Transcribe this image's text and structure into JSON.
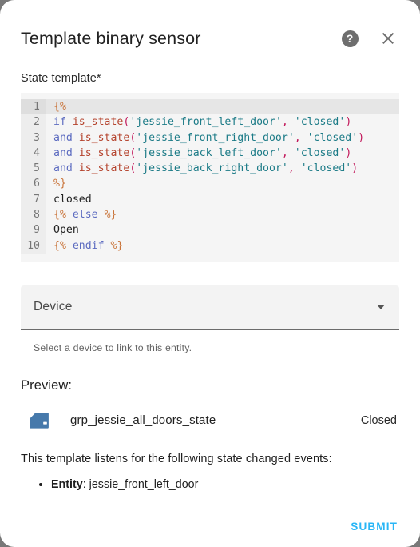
{
  "dialog": {
    "title": "Template binary sensor",
    "help_icon": "help-circle-icon",
    "close_icon": "close-icon"
  },
  "state_template": {
    "label": "State template*",
    "lines": [
      {
        "number": "1",
        "active": true,
        "tokens": [
          {
            "t": "tag",
            "v": "{%"
          }
        ]
      },
      {
        "number": "2",
        "active": false,
        "tokens": [
          {
            "t": "kw",
            "v": "if"
          },
          {
            "t": "plain",
            "v": " "
          },
          {
            "t": "fn",
            "v": "is_state"
          },
          {
            "t": "punc",
            "v": "("
          },
          {
            "t": "str",
            "v": "'jessie_front_left_door'"
          },
          {
            "t": "punc",
            "v": ","
          },
          {
            "t": "plain",
            "v": " "
          },
          {
            "t": "str",
            "v": "'closed'"
          },
          {
            "t": "punc",
            "v": ")"
          }
        ]
      },
      {
        "number": "3",
        "active": false,
        "tokens": [
          {
            "t": "kw",
            "v": "and"
          },
          {
            "t": "plain",
            "v": " "
          },
          {
            "t": "fn",
            "v": "is_state"
          },
          {
            "t": "punc",
            "v": "("
          },
          {
            "t": "str",
            "v": "'jessie_front_right_door'"
          },
          {
            "t": "punc",
            "v": ","
          },
          {
            "t": "plain",
            "v": " "
          },
          {
            "t": "str",
            "v": "'closed'"
          },
          {
            "t": "punc",
            "v": ")"
          }
        ]
      },
      {
        "number": "4",
        "active": false,
        "tokens": [
          {
            "t": "kw",
            "v": "and"
          },
          {
            "t": "plain",
            "v": " "
          },
          {
            "t": "fn",
            "v": "is_state"
          },
          {
            "t": "punc",
            "v": "("
          },
          {
            "t": "str",
            "v": "'jessie_back_left_door'"
          },
          {
            "t": "punc",
            "v": ","
          },
          {
            "t": "plain",
            "v": " "
          },
          {
            "t": "str",
            "v": "'closed'"
          },
          {
            "t": "punc",
            "v": ")"
          }
        ]
      },
      {
        "number": "5",
        "active": false,
        "tokens": [
          {
            "t": "kw",
            "v": "and"
          },
          {
            "t": "plain",
            "v": " "
          },
          {
            "t": "fn",
            "v": "is_state"
          },
          {
            "t": "punc",
            "v": "("
          },
          {
            "t": "str",
            "v": "'jessie_back_right_door'"
          },
          {
            "t": "punc",
            "v": ","
          },
          {
            "t": "plain",
            "v": " "
          },
          {
            "t": "str",
            "v": "'closed'"
          },
          {
            "t": "punc",
            "v": ")"
          }
        ]
      },
      {
        "number": "6",
        "active": false,
        "tokens": [
          {
            "t": "tag",
            "v": "%}"
          }
        ]
      },
      {
        "number": "7",
        "active": false,
        "tokens": [
          {
            "t": "plain",
            "v": "closed"
          }
        ]
      },
      {
        "number": "8",
        "active": false,
        "tokens": [
          {
            "t": "tag",
            "v": "{%"
          },
          {
            "t": "plain",
            "v": " "
          },
          {
            "t": "kw",
            "v": "else"
          },
          {
            "t": "plain",
            "v": " "
          },
          {
            "t": "tag",
            "v": "%}"
          }
        ]
      },
      {
        "number": "9",
        "active": false,
        "tokens": [
          {
            "t": "plain",
            "v": "Open"
          }
        ]
      },
      {
        "number": "10",
        "active": false,
        "tokens": [
          {
            "t": "tag",
            "v": "{%"
          },
          {
            "t": "plain",
            "v": " "
          },
          {
            "t": "kw",
            "v": "endif"
          },
          {
            "t": "plain",
            "v": " "
          },
          {
            "t": "tag",
            "v": "%}"
          }
        ]
      }
    ]
  },
  "device_select": {
    "value": "Device",
    "helper": "Select a device to link to this entity.",
    "caret_icon": "chevron-down-icon"
  },
  "preview": {
    "title": "Preview:",
    "entity_icon": "car-door-icon",
    "entity_name": "grp_jessie_all_doors_state",
    "entity_state": "Closed"
  },
  "listeners": {
    "intro": "This template listens for the following state changed events:",
    "items": [
      {
        "key": "Entity",
        "separator": ": ",
        "value": "jessie_front_left_door"
      }
    ]
  },
  "footer": {
    "submit_label": "SUBMIT",
    "accent_color": "#29b6f6"
  }
}
